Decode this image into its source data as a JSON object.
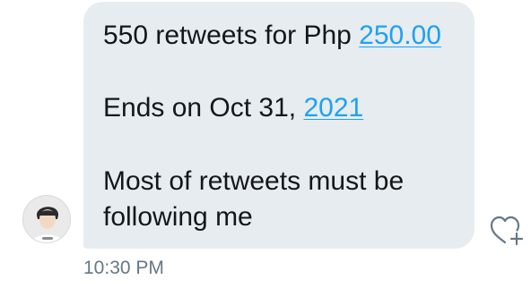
{
  "message": {
    "line1_text": "550 retweets for Php ",
    "line1_link": "250.00",
    "line2_text": "Ends on Oct 31, ",
    "line2_link": "2021",
    "line3_text": "Most of retweets must be",
    "line4_text": "following me"
  },
  "timestamp": "10:30 PM",
  "icons": {
    "avatar": "user-avatar",
    "like": "heart-plus-icon"
  },
  "colors": {
    "bubble": "#e6ecf0",
    "link": "#1da1f2",
    "text": "#14171a",
    "timestamp": "#657786"
  }
}
